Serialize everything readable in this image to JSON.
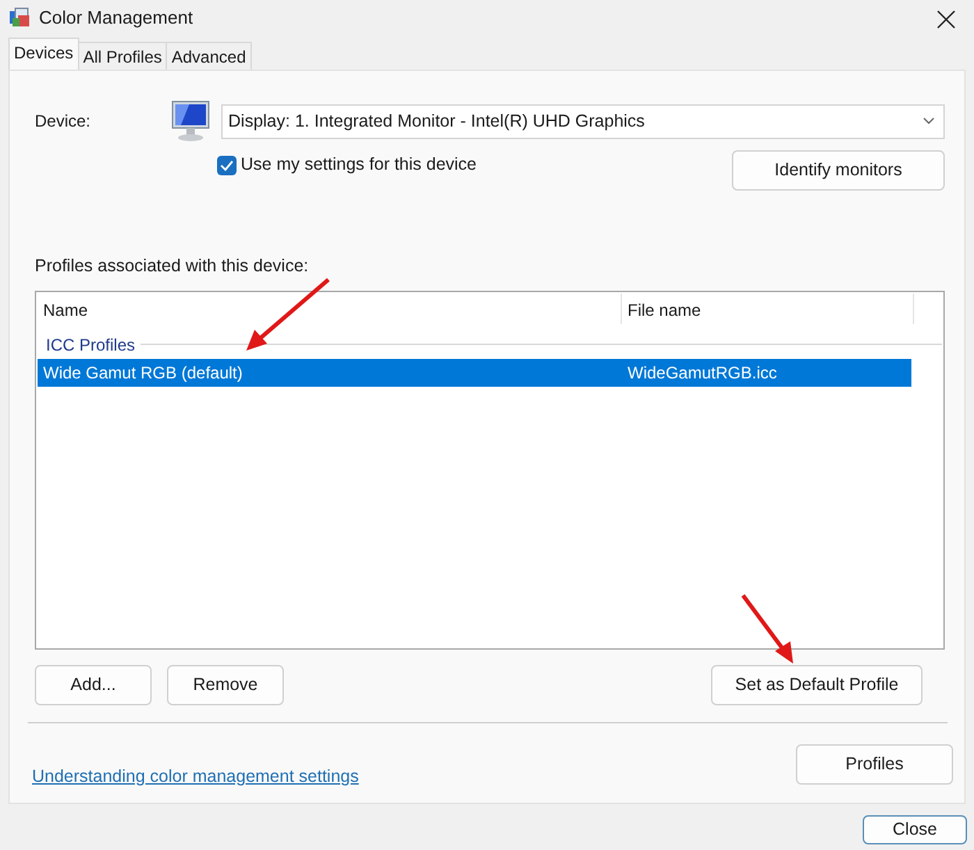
{
  "window": {
    "title": "Color Management"
  },
  "tabs": [
    {
      "label": "Devices",
      "selected": true
    },
    {
      "label": "All Profiles",
      "selected": false
    },
    {
      "label": "Advanced",
      "selected": false
    }
  ],
  "device": {
    "label": "Device:",
    "value": "Display: 1. Integrated Monitor - Intel(R) UHD Graphics"
  },
  "use_my_settings": {
    "label": "Use my settings for this device",
    "checked": true
  },
  "identify_button": "Identify monitors",
  "profiles_label": "Profiles associated with this device:",
  "table": {
    "columns": [
      "Name",
      "File name"
    ],
    "groups": [
      {
        "title": "ICC Profiles",
        "rows": [
          {
            "name": "Wide Gamut RGB (default)",
            "file": "WideGamutRGB.icc",
            "selected": true
          }
        ]
      }
    ]
  },
  "list_buttons": [
    "Add...",
    "Remove"
  ],
  "default_button": "Set as Default Profile",
  "help_link": "Understanding color management settings",
  "profiles_button": "Profiles",
  "close_button": "Close"
}
